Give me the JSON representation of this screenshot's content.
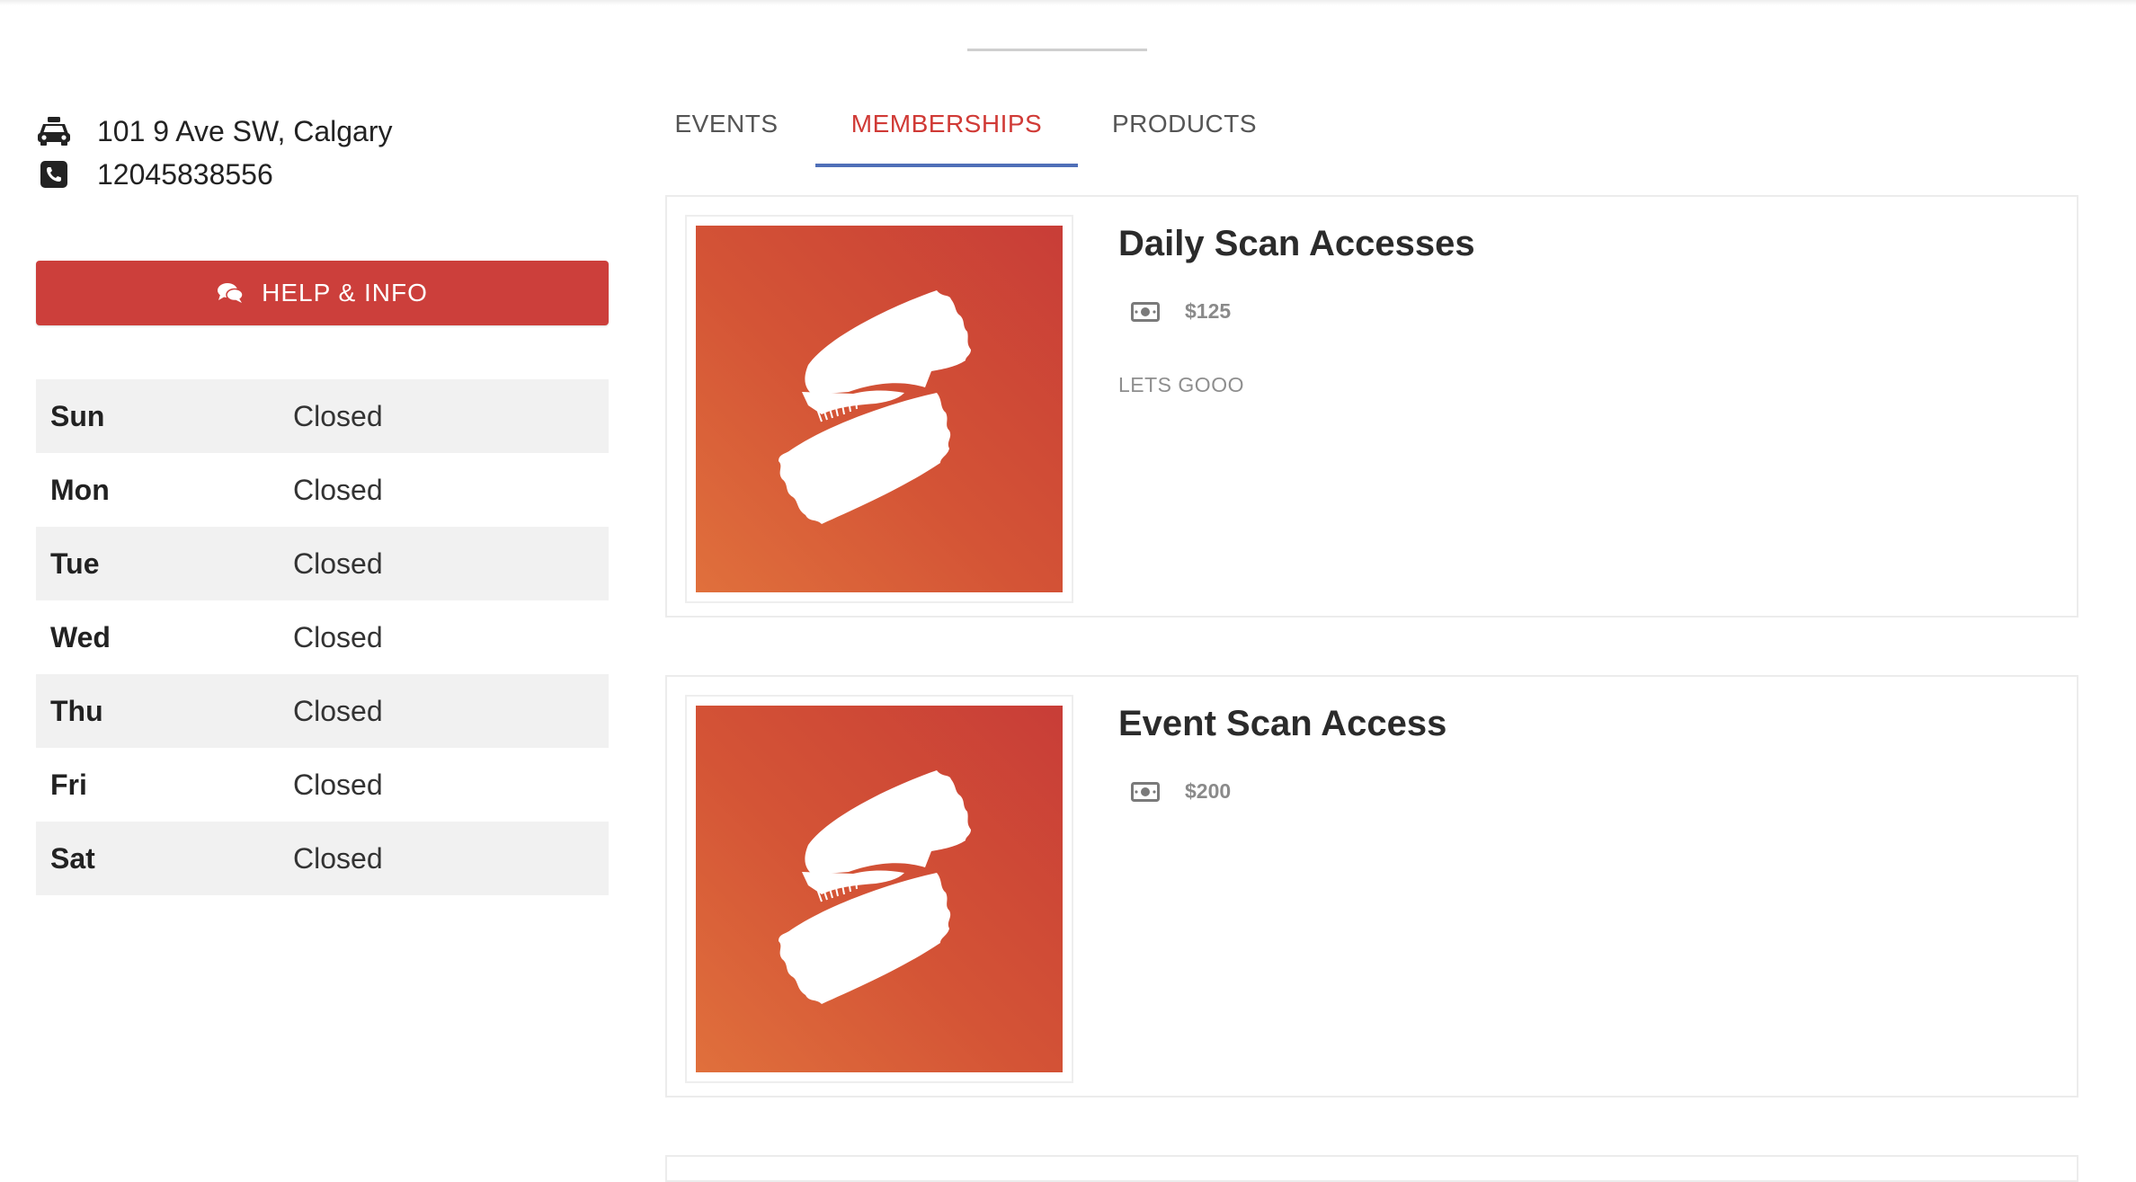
{
  "location": {
    "address": "101 9 Ave SW, Calgary",
    "phone": "12045838556",
    "address_icon": "taxi-icon",
    "phone_icon": "phone-square-icon"
  },
  "help_button": {
    "label": "HELP & INFO",
    "icon": "comments-icon"
  },
  "hours": [
    {
      "day": "Sun",
      "status": "Closed"
    },
    {
      "day": "Mon",
      "status": "Closed"
    },
    {
      "day": "Tue",
      "status": "Closed"
    },
    {
      "day": "Wed",
      "status": "Closed"
    },
    {
      "day": "Thu",
      "status": "Closed"
    },
    {
      "day": "Fri",
      "status": "Closed"
    },
    {
      "day": "Sat",
      "status": "Closed"
    }
  ],
  "tabs": [
    {
      "label": "EVENTS",
      "active": false
    },
    {
      "label": "MEMBERSHIPS",
      "active": true
    },
    {
      "label": "PRODUCTS",
      "active": false
    }
  ],
  "memberships": [
    {
      "title": "Daily Scan Accesses",
      "price": "$125",
      "description": "LETS GOOO",
      "image_icon": "tickets-icon"
    },
    {
      "title": "Event Scan Access",
      "price": "$200",
      "description": "",
      "image_icon": "tickets-icon"
    }
  ],
  "colors": {
    "accent_red": "#cc3f3b",
    "active_tab_text": "#d03a36",
    "active_tab_underline": "#4f6fb8",
    "thumbnail_gradient_start": "#e0703c",
    "thumbnail_gradient_end": "#c83d37"
  }
}
